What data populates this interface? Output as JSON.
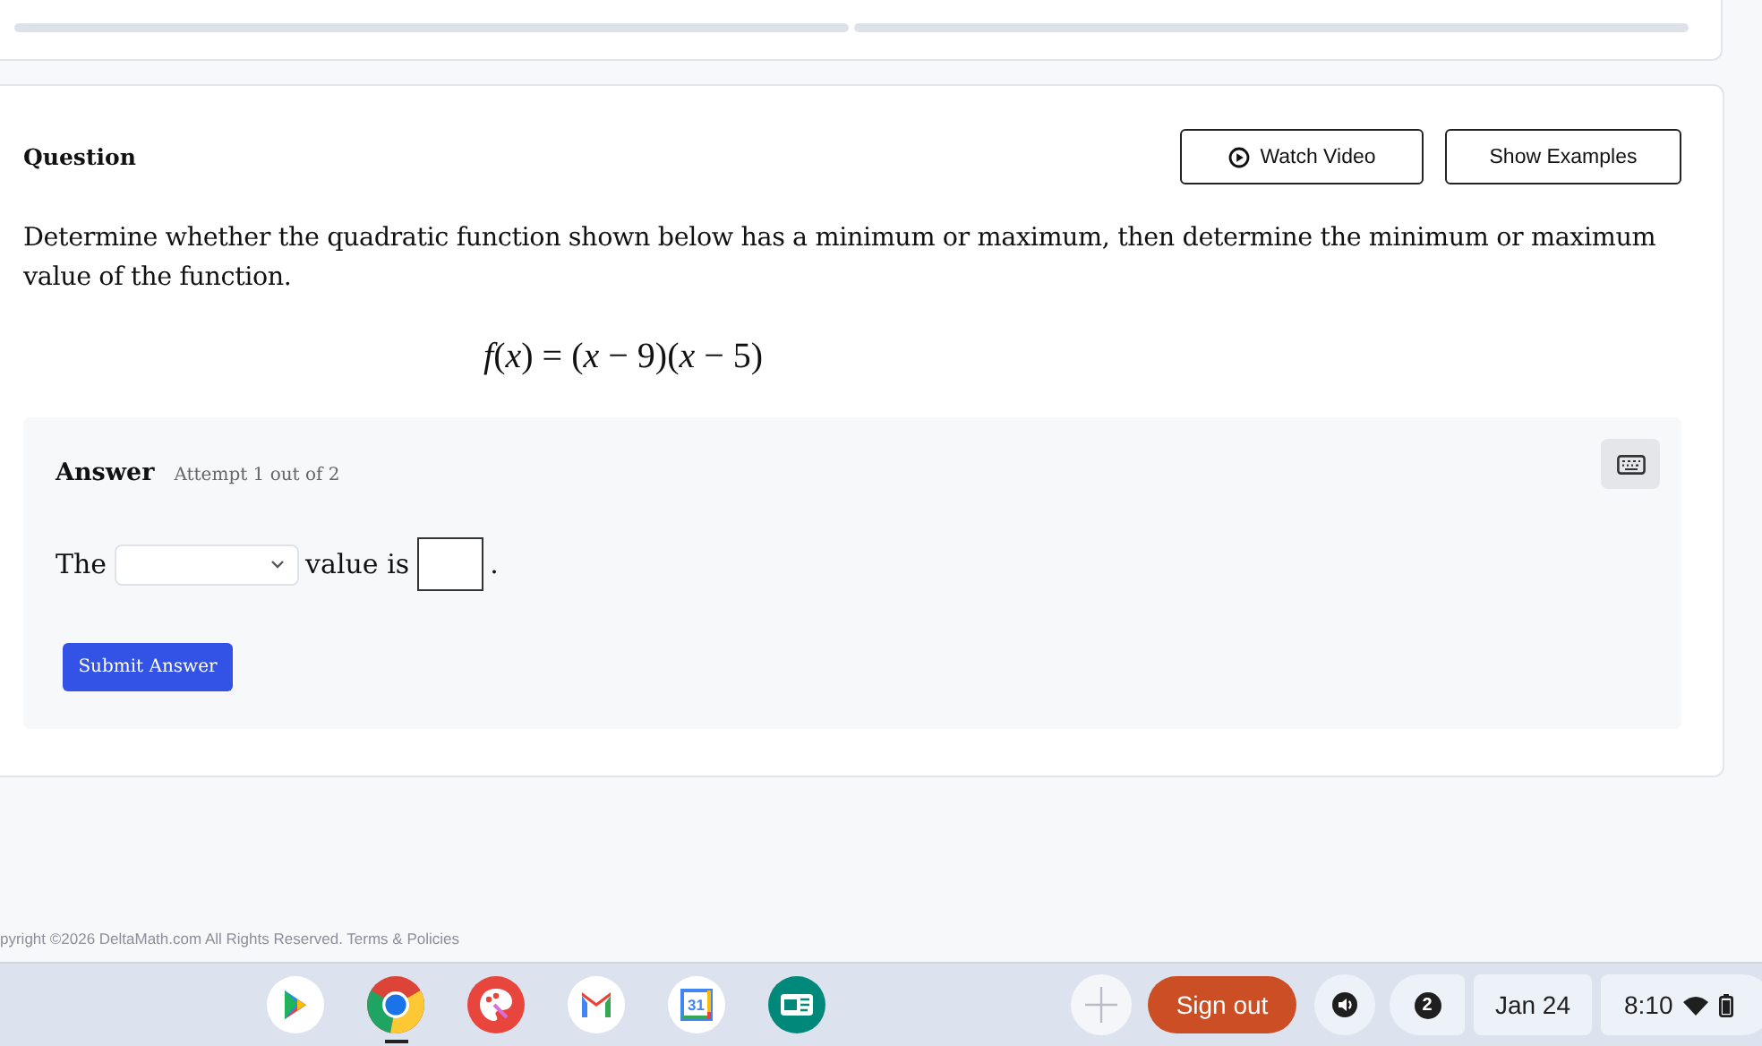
{
  "progress": {
    "segments": [
      {
        "level": 0
      },
      {
        "level": 0
      }
    ]
  },
  "question": {
    "heading": "Question",
    "buttons": [
      {
        "kind": "video",
        "label": "Watch Video"
      },
      {
        "kind": "plain",
        "label": "Show Examples"
      }
    ],
    "prompt": "Determine whether the quadratic function shown below has a minimum or maximum, then determine the minimum or maximum value of the function.",
    "formula": "*f*(*x*) = (*x* − 9)(*x* − 5)"
  },
  "answer": {
    "heading": "Answer",
    "attempt": "Attempt 1 out of 2",
    "sentence": [
      {
        "kind": "text",
        "text": "The"
      },
      {
        "kind": "select"
      },
      {
        "kind": "text",
        "text": "value is"
      },
      {
        "kind": "input"
      },
      {
        "kind": "text",
        "text": "."
      }
    ],
    "submit": "Submit Answer"
  },
  "footer": "pyright ©2026 DeltaMath.com All Rights Reserved. Terms & Policies",
  "shelf": {
    "apps": [
      {
        "kind": "play",
        "active": false
      },
      {
        "kind": "browser",
        "active": true
      },
      {
        "kind": "palette",
        "active": false
      },
      {
        "kind": "mail",
        "active": false
      },
      {
        "kind": "calendar",
        "label": "31",
        "active": false
      },
      {
        "kind": "card",
        "active": false
      }
    ],
    "sign_out": "Sign out",
    "notifications": "2",
    "date": "Jan 24",
    "time": "8:10"
  }
}
